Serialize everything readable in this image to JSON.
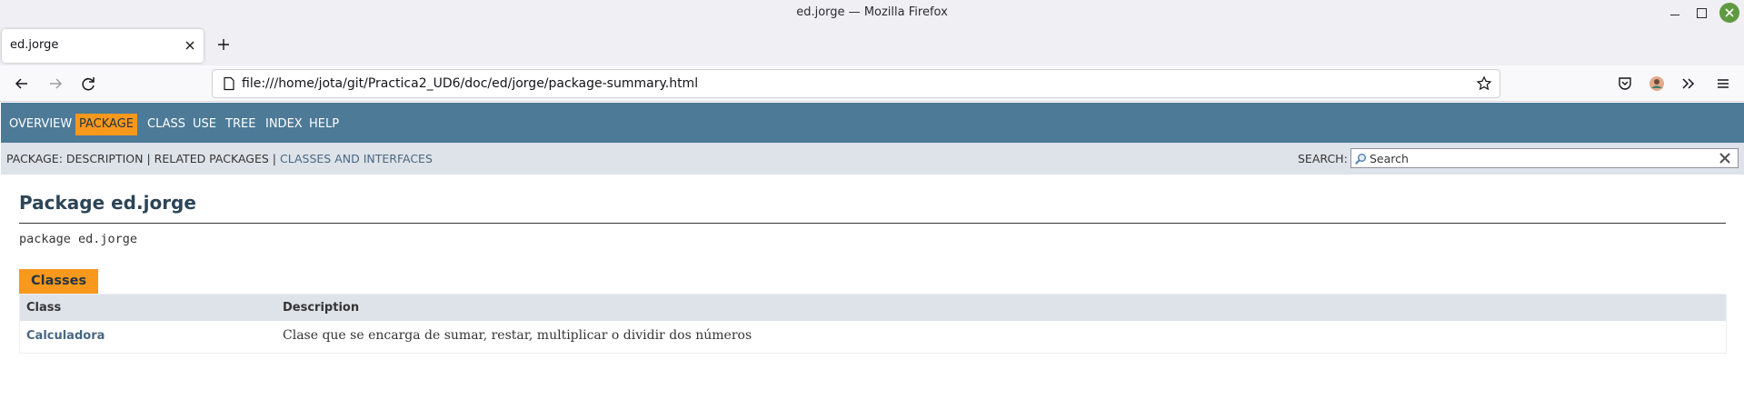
{
  "window": {
    "title": "ed.jorge — Mozilla Firefox"
  },
  "tabs": [
    {
      "label": "ed.jorge"
    }
  ],
  "urlbar": {
    "url": "file:///home/jota/git/Practica2_UD6/doc/ed/jorge/package-summary.html"
  },
  "javadoc": {
    "top_nav": [
      "OVERVIEW",
      "PACKAGE",
      "CLASS",
      "USE",
      "TREE",
      "INDEX",
      "HELP"
    ],
    "active_nav": "PACKAGE",
    "sub_nav": {
      "prefix": "PACKAGE: DESCRIPTION | RELATED PACKAGES | ",
      "link": "CLASSES AND INTERFACES"
    },
    "search": {
      "label": "SEARCH:",
      "placeholder": "Search",
      "value": ""
    },
    "title": "Package ed.jorge",
    "declaration": "package ed.jorge",
    "summary": {
      "caption": "Classes",
      "headers": [
        "Class",
        "Description"
      ],
      "rows": [
        {
          "name": "Calculadora",
          "description": "Clase que se encarga de sumar, restar, multiplicar o dividir dos números"
        }
      ]
    }
  },
  "colors": {
    "nav_bar": "#4d7a97",
    "active_tab": "#f8981d",
    "sub_nav": "#dee3e9",
    "link": "#4a6782",
    "heading": "#2c4557"
  }
}
